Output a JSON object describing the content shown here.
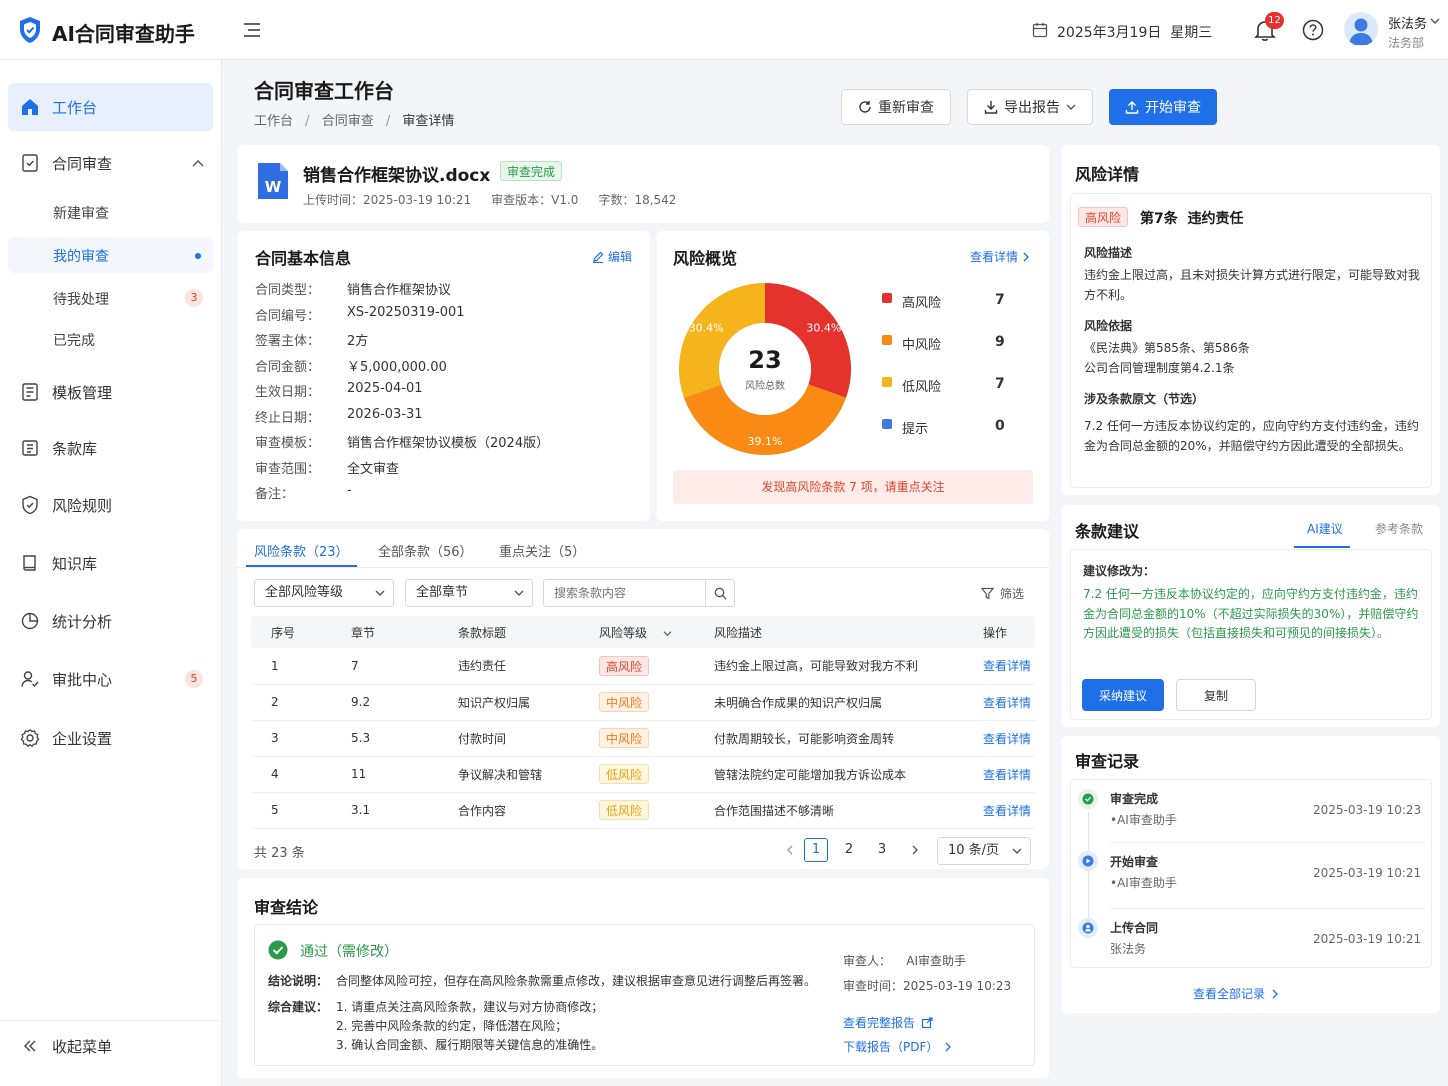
{
  "app": {
    "title": "AI合同审查助手"
  },
  "header": {
    "date": "2025年3月19日",
    "weekday": "星期三",
    "notification_count": "12",
    "user_name": "张法务",
    "user_dept": "法务部"
  },
  "sidebar": {
    "items": [
      {
        "label": "工作台"
      },
      {
        "label": "合同审查"
      },
      {
        "label": "模板管理"
      },
      {
        "label": "条款库"
      },
      {
        "label": "风险规则"
      },
      {
        "label": "知识库"
      },
      {
        "label": "统计分析"
      },
      {
        "label": "审批中心",
        "badge": "5"
      },
      {
        "label": "企业设置"
      }
    ],
    "sub_items": [
      {
        "label": "新建审查"
      },
      {
        "label": "我的审查"
      },
      {
        "label": "待我处理",
        "badge": "3"
      },
      {
        "label": "已完成"
      }
    ],
    "collapse_label": "收起菜单"
  },
  "page": {
    "title": "合同审查工作台",
    "breadcrumb": [
      "工作台",
      "合同审查",
      "审查详情"
    ],
    "breadcrumb_sep": "/",
    "actions": {
      "rereview": "重新审查",
      "export": "导出报告",
      "start": "开始审查"
    }
  },
  "file": {
    "icon_letter": "W",
    "name": "销售合作框架协议.docx",
    "status": "审查完成",
    "upload_time": "上传时间：2025-03-19 10:21",
    "version": "审查版本：V1.0",
    "word_count": "字数：18,542"
  },
  "basic_info": {
    "title": "合同基本信息",
    "edit_label": "编辑",
    "rows": [
      {
        "label": "合同类型：",
        "value": "销售合作框架协议"
      },
      {
        "label": "合同编号：",
        "value": "XS-20250319-001"
      },
      {
        "label": "签署主体：",
        "value": "2方"
      },
      {
        "label": "合同金额：",
        "value": "￥5,000,000.00"
      },
      {
        "label": "生效日期：",
        "value": "2025-04-01"
      },
      {
        "label": "终止日期：",
        "value": "2026-03-31"
      },
      {
        "label": "审查模板：",
        "value": "销售合作框架协议模板（2024版）"
      },
      {
        "label": "审查范围：",
        "value": "全文审查"
      },
      {
        "label": "备注：",
        "value": "-"
      }
    ]
  },
  "risk_overview": {
    "title": "风险概览",
    "detail_link": "查看详情",
    "total": "23",
    "total_label": "风险总数",
    "slice_labels": {
      "high": "30.4%",
      "mid": "39.1%",
      "low": "30.4%"
    },
    "legend": [
      {
        "label": "高风险",
        "count": "7",
        "color": "#e5322d"
      },
      {
        "label": "中风险",
        "count": "9",
        "color": "#f98a14"
      },
      {
        "label": "低风险",
        "count": "7",
        "color": "#f5b41b"
      },
      {
        "label": "提示",
        "count": "0",
        "color": "#3f7ae0"
      }
    ],
    "alert": "发现高风险条款 7 项，请重点关注"
  },
  "chart_data": {
    "type": "pie",
    "categories": [
      "高风险",
      "中风险",
      "低风险",
      "提示"
    ],
    "values": [
      7,
      9,
      7,
      0
    ],
    "percent_labels": [
      "30.4%",
      "39.1%",
      "30.4%",
      ""
    ],
    "colors": [
      "#e5322d",
      "#f98a14",
      "#f5b41b",
      "#3f7ae0"
    ],
    "center_label": "23",
    "center_sublabel": "风险总数",
    "legend_position": "right"
  },
  "clauses": {
    "tabs": [
      "风险条款（23）",
      "全部条款（56）",
      "重点关注（5）"
    ],
    "filter_level": "全部风险等级",
    "filter_chapter": "全部章节",
    "search_placeholder": "搜索条款内容",
    "filter_label": "筛选",
    "columns": [
      "序号",
      "章节",
      "条款标题",
      "风险等级",
      "风险描述",
      "操作"
    ],
    "rows": [
      {
        "no": "1",
        "chapter": "7",
        "title": "违约责任",
        "level": "高风险",
        "level_class": "high",
        "desc": "违约金上限过高，可能导致对我方不利",
        "action": "查看详情"
      },
      {
        "no": "2",
        "chapter": "9.2",
        "title": "知识产权归属",
        "level": "中风险",
        "level_class": "mid",
        "desc": "未明确合作成果的知识产权归属",
        "action": "查看详情"
      },
      {
        "no": "3",
        "chapter": "5.3",
        "title": "付款时间",
        "level": "中风险",
        "level_class": "mid",
        "desc": "付款周期较长，可能影响资金周转",
        "action": "查看详情"
      },
      {
        "no": "4",
        "chapter": "11",
        "title": "争议解决和管辖",
        "level": "低风险",
        "level_class": "low",
        "desc": "管辖法院约定可能增加我方诉讼成本",
        "action": "查看详情"
      },
      {
        "no": "5",
        "chapter": "3.1",
        "title": "合作内容",
        "level": "低风险",
        "level_class": "low",
        "desc": "合作范围描述不够清晰",
        "action": "查看详情"
      }
    ],
    "total": "共 23 条",
    "pages": [
      "1",
      "2",
      "3"
    ],
    "page_size": "10 条/页"
  },
  "conclusion": {
    "title": "审查结论",
    "result": "通过（需修改）",
    "desc_label": "结论说明：",
    "desc": "合同整体风险可控，但存在高风险条款需重点修改，建议根据审查意见进行调整后再签署。",
    "advice_label": "综合建议：",
    "advice": [
      "1. 请重点关注高风险条款，建议与对方协商修改；",
      "2. 完善中风险条款的约定，降低潜在风险；",
      "3. 确认合同金额、履行期限等关键信息的准确性。"
    ],
    "reviewer": "审查人：    AI审查助手",
    "review_time": "审查时间：2025-03-19 10:23",
    "full_report": "查看完整报告",
    "download": "下载报告（PDF）"
  },
  "risk_detail": {
    "title": "风险详情",
    "level": "高风险",
    "clause": "第7条  违约责任",
    "desc_title": "风险描述",
    "desc": "违约金上限过高，且未对损失计算方式进行限定，可能导致对我方不利。",
    "basis_title": "风险依据",
    "basis": [
      "《民法典》第585条、第586条",
      "公司合同管理制度第4.2.1条"
    ],
    "origin_title": "涉及条款原文（节选）",
    "origin": "7.2 任何一方违反本协议约定的，应向守约方支付违约金，违约金为合同总金额的20%，并赔偿守约方因此遭受的全部损失。"
  },
  "suggestion": {
    "title": "条款建议",
    "tabs": [
      "AI建议",
      "参考条款"
    ],
    "heading": "建议修改为：",
    "text": "7.2 任何一方违反本协议约定的，应向守约方支付违约金，违约金为合同总金额的10%（不超过实际损失的30%），并赔偿守约方因此遭受的损失（包括直接损失和可预见的间接损失）。",
    "adopt": "采纳建议",
    "copy": "复制"
  },
  "records": {
    "title": "审查记录",
    "items": [
      {
        "title": "审查完成",
        "by": "•AI审查助手",
        "time": "2025-03-19 10:23"
      },
      {
        "title": "开始审查",
        "by": "•AI审查助手",
        "time": "2025-03-19 10:21"
      },
      {
        "title": "上传合同",
        "by": "张法务",
        "time": "2025-03-19 10:21"
      }
    ],
    "all_link": "查看全部记录"
  }
}
